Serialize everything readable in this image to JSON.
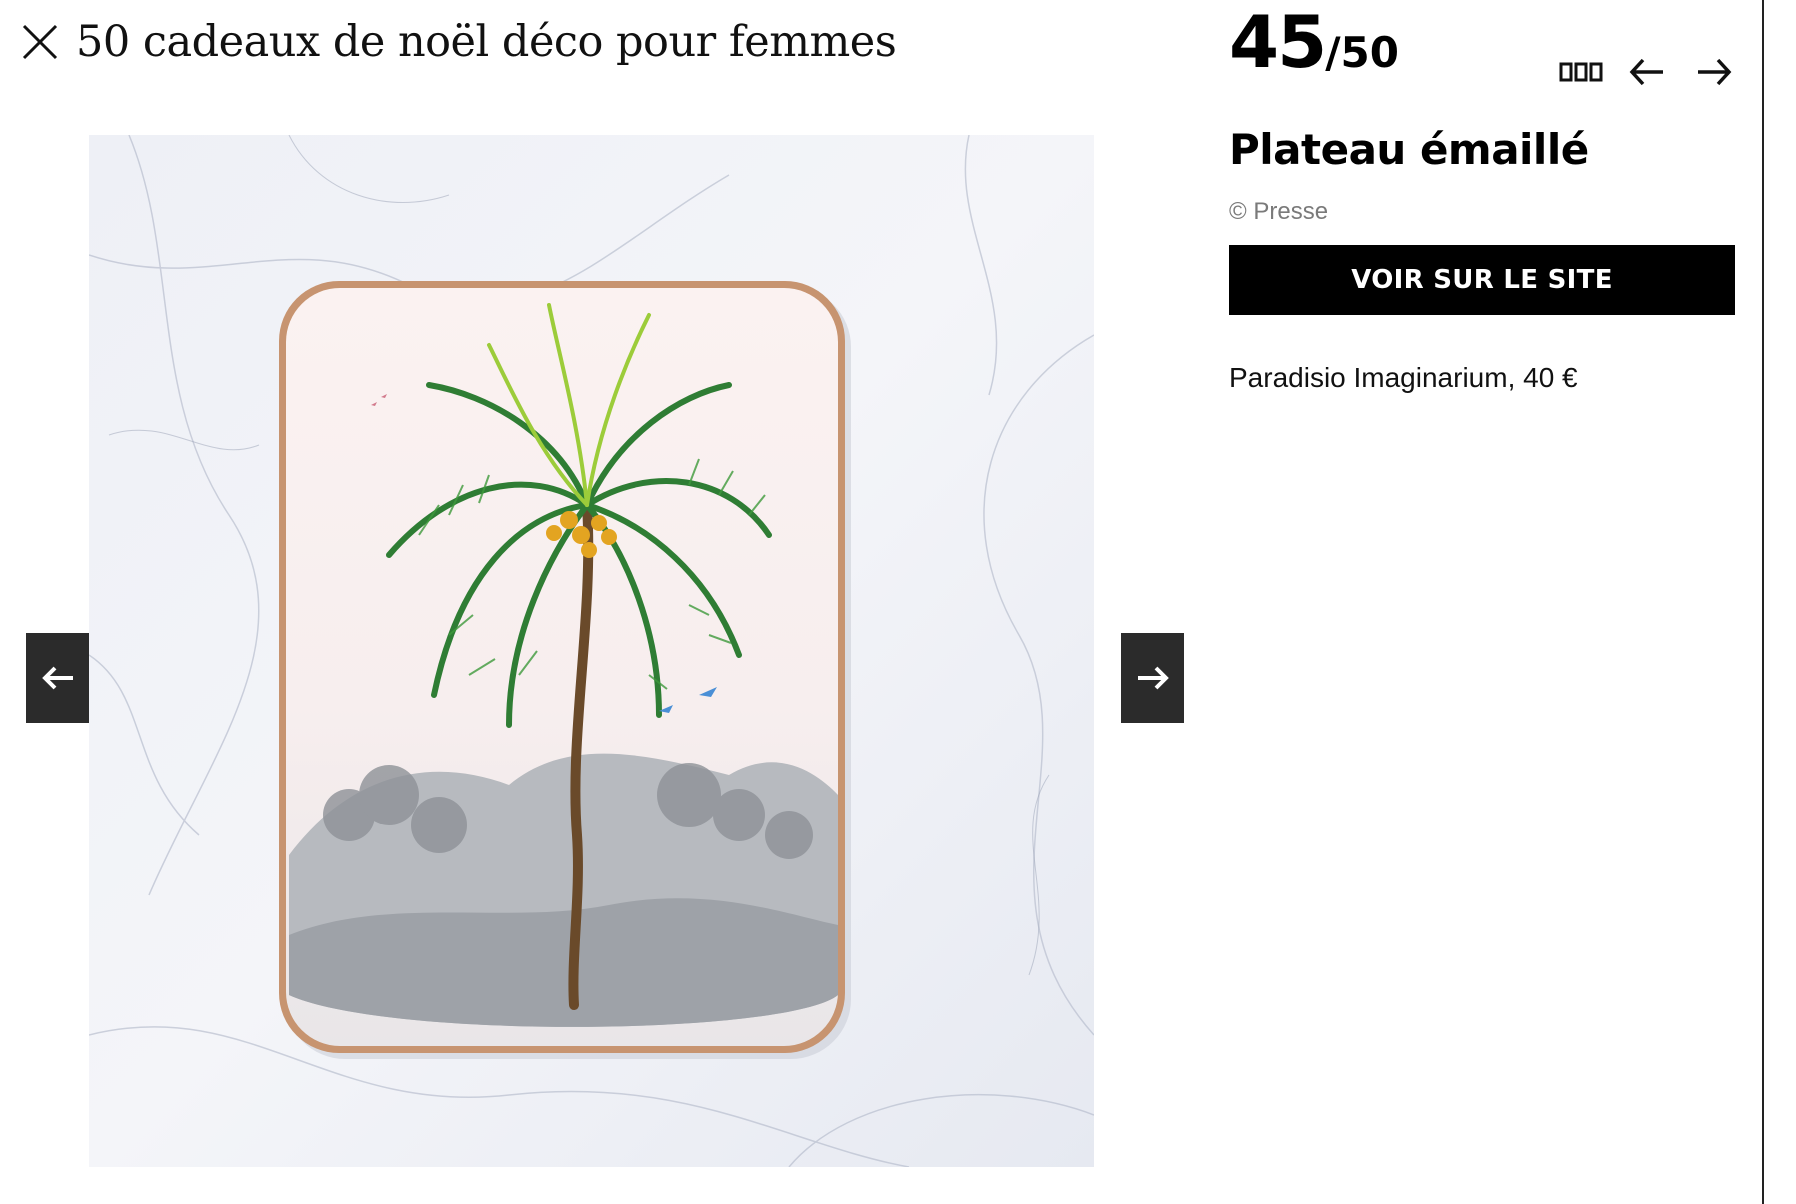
{
  "header": {
    "close_icon": "close-icon",
    "title": "50 cadeaux de noël déco pour femmes"
  },
  "counter": {
    "current": "45",
    "total": "/50"
  },
  "toolbar": {
    "grid_icon": "grid-view-icon",
    "prev_icon": "arrow-left-icon",
    "next_icon": "arrow-right-icon"
  },
  "item": {
    "title": "Plateau émaillé",
    "credit": "© Presse",
    "cta_label": "VOIR SUR LE SITE",
    "description": "Paradisio Imaginarium, 40 €"
  },
  "slideshow": {
    "prev_icon": "arrow-left-icon",
    "next_icon": "arrow-right-icon"
  },
  "colors": {
    "cta_background": "#000000",
    "arrow_background": "#2b2b2b",
    "credit_text": "#7a7a7a"
  }
}
